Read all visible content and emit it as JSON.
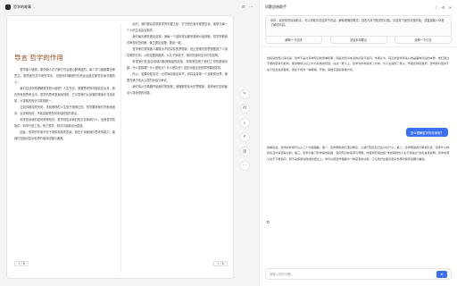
{
  "app": {
    "title": "哲学的故事",
    "chevron": "›"
  },
  "topbar_icons": [
    "≡",
    "⋯"
  ],
  "reader": {
    "chapter_title": "导言 哲学的作用",
    "left_paragraphs": [
      "哲学使人愉快，那些使人在了解它们后便心醉神迷的。每个学习者都要全神贯注，虽然他们并不研究学问，但是他们懂得的东西远远超过那些熟读书籍的人。",
      "我们应该怎样理解哲学的价值呢？人生在世，需要思考的问题实在太多，而在所有的思考当中，哲学的思考是最深刻的。它引导我们从纷繁的现象中寻找本质，从零散的知识中发现统一。",
      "正如苏格拉底所说，未经审视的人生是不值得过的。哲学要求我们不断地追问、反省和批判，不轻易接受任何未经检验的观点。",
      "科学告诉我们如何获得知识，哲学则告诉我们知识意味着什么。没有哲学的指引，科学只是工具；有了哲学，知识才能转化为智慧。",
      "因此，哲学的作用不在于提供现成的答案，而在于训练我们思考的能力，使我们在面对复杂世界时保持清醒与谦逊。"
    ],
    "right_paragraphs": [
      "此时，我们便会发现哲学的可爱之处：它不是在象牙塔里空谈，而是与每一个人的生活息息相关。",
      "我们每天都在做出选择，而每一个选择背后都有某种价值判断。哲学帮助我们审视这些判断，使之更加合理、更加一致。",
      "哲学家们常常被人嘲笑为不切实际的梦想家，但正是他们的思想塑造了人类文明的方向。从柏拉图到康德，从孔子到老子，他们的追问至今仍在回响。",
      "科学家们在各自领域内取得辉煌的成就，却常常忽视了他们工作的基础问题：什么是真理？什么是知识？什么是存在？这些问题正是哲学所要回答的。",
      "所以，如果你愿意花一点时间阅读这本书，你将会发现一个全新的世界，那里充满了伟大心灵的对话与争论。",
      "我们将从古希腊开始我们的旅程，追随那些伟大的思想家，看看他们如何面对人类永恒的问题。"
    ],
    "page_left": "1 / 8",
    "page_right": "1 / 8"
  },
  "tools": [
    {
      "name": "highlight-icon",
      "glyph": "✎"
    },
    {
      "name": "ai-icon",
      "glyph": "AI"
    },
    {
      "name": "search-icon",
      "glyph": "⌕"
    },
    {
      "name": "note-icon",
      "glyph": "✐"
    },
    {
      "name": "translate-icon",
      "glyph": "译"
    },
    {
      "name": "more-icon",
      "glyph": "⋯"
    }
  ],
  "panel": {
    "title": "问题总结助手",
    "icons": [
      "☾",
      "⚙",
      "✕"
    ],
    "note": "你好，我是你的阅读助手，可以帮助你总结章节内容、解释难懂的概念、回答与本书相关的问题。请选择下面的问题开始，或直接输入你想了解的内容。",
    "prompts": [
      "解释一下这段",
      "总结本章要点",
      "延伸一下讨论"
    ],
    "answer1": "这段话的核心观点是：哲学不是对具体知识的简单积累，而是对知识本身的反思与追问。作者认为，真正的哲学家关心的是事物背后的本质，他们通过不断的思考与批判，使零散的认识上升为系统的智慧。在这一意义上，哲学为科学提供了方向，为人生提供了意义。作者还特别强调，哲学的价值并不在于给出最终答案，而在于培养一种审慎、开放、追根究底的思维方式。",
    "user_question": "怎么理解哲学的作用呢？",
    "answer2": "简单来说，哲学的作用可以从三个方面理解。第一，哲学帮助我们澄清概念，让我们知道自己在讨论什么；第二，哲学帮助我们审视价值，思考什么样的生活才是值得过的；第三，哲学为各门科学提供基础，追问知识的来源与界限。作者用苏格拉底“未经审视的人生不值得过”的名言来说明，哲学的意义在于不断追问，而不是停留在现成的结论上。你可以把哲学理解为一种思考的训练，它让我们在面对复杂世界时保持清醒与谦逊。",
    "input_placeholder": "请输入你的问题...",
    "send_glyph": "➤"
  }
}
